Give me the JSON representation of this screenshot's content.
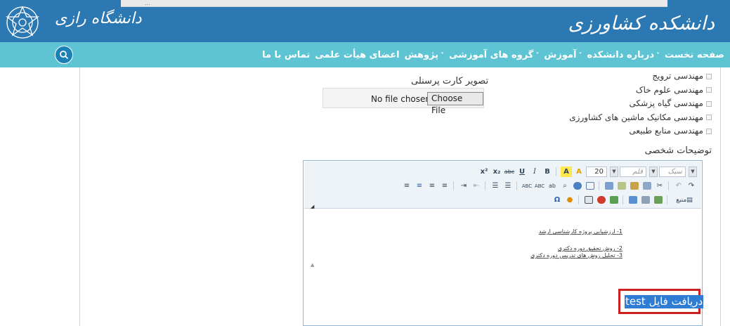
{
  "header": {
    "brand_left": "دانشگاه رازی",
    "brand_right": "دانشکده کشاورزی",
    "browser_strip_text": "..."
  },
  "nav": {
    "items": [
      {
        "label": "صفحه نخست",
        "has_dropdown": false
      },
      {
        "label": "درباره دانشکده",
        "has_dropdown": true
      },
      {
        "label": "آموزش",
        "has_dropdown": true
      },
      {
        "label": "گروه های آموزشی",
        "has_dropdown": true
      },
      {
        "label": "پژوهش",
        "has_dropdown": true
      },
      {
        "label": "اعضای هیأت علمی",
        "has_dropdown": false
      },
      {
        "label": "تماس با ما",
        "has_dropdown": false
      }
    ],
    "dropdown_glyph": "˅",
    "search_icon": "search-icon"
  },
  "form": {
    "departments": [
      "مهندسی ترویج",
      "مهندسی علوم خاک",
      "مهندسی گیاه پزشکی",
      "مهندسی مکانیک ماشین های کشاورزی",
      "مهندسی منابع طبیعی"
    ],
    "photo_label": "تصویر کارت پرسنلی",
    "file_status": "No file chosen",
    "choose_file": "Choose File",
    "notes_label": "توضیحات شخصی"
  },
  "editor": {
    "style_select": "سبک",
    "font_select": "قلم",
    "size_select": "20",
    "source_label": "منبع",
    "lines": [
      "1- ارزشیابی پروژه کارشناسی ارشد",
      "2- روش تحقیق دوره دکتری",
      "3- تحلیل روش های تدریس دوره دکتری"
    ],
    "highlighted_text": "دریافت فایل test"
  },
  "colors": {
    "header": "#2b78b2",
    "nav": "#5ec4d3",
    "highlight": "#2f7cd5",
    "annotation": "#cc1f1f"
  }
}
